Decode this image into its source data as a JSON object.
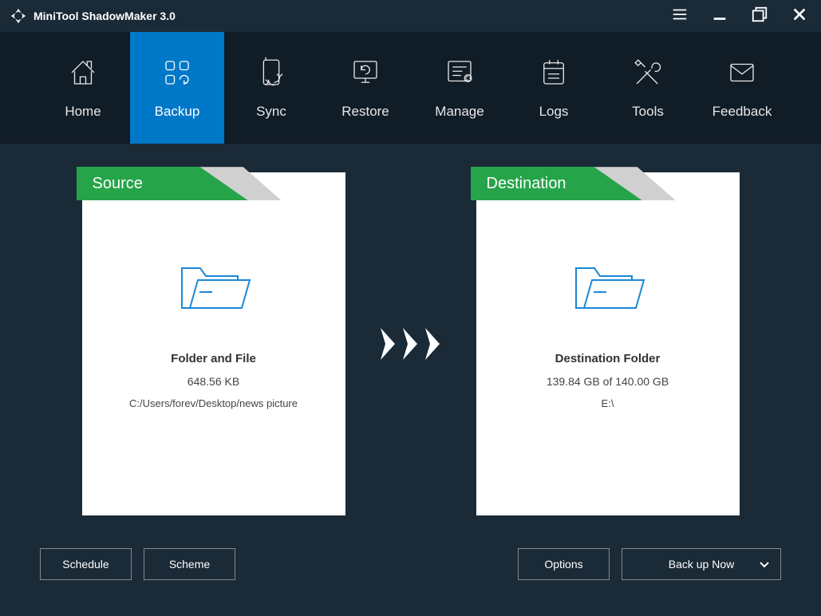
{
  "app": {
    "title": "MiniTool ShadowMaker 3.0"
  },
  "nav": {
    "items": [
      {
        "label": "Home"
      },
      {
        "label": "Backup",
        "active": true
      },
      {
        "label": "Sync"
      },
      {
        "label": "Restore"
      },
      {
        "label": "Manage"
      },
      {
        "label": "Logs"
      },
      {
        "label": "Tools"
      },
      {
        "label": "Feedback"
      }
    ]
  },
  "source": {
    "tab": "Source",
    "title": "Folder and File",
    "size": "648.56 KB",
    "path": "C:/Users/forev/Desktop/news picture"
  },
  "destination": {
    "tab": "Destination",
    "title": "Destination Folder",
    "size": "139.84 GB of 140.00 GB",
    "path": "E:\\"
  },
  "footer": {
    "schedule": "Schedule",
    "scheme": "Scheme",
    "options": "Options",
    "backup_now": "Back up Now"
  }
}
